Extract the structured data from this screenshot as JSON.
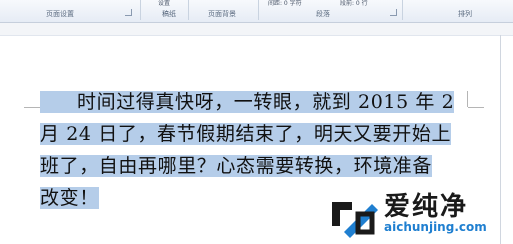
{
  "ribbon": {
    "group_labels": [
      "页面设置",
      "稿纸",
      "页面背景",
      "段落",
      "排列"
    ],
    "controls": [
      "设置",
      "间距: 0 字符",
      "段前: 0 行"
    ]
  },
  "document": {
    "lines": [
      "时间过得真快呀，一转眼，就到 2015 年 2",
      "月 24 日了，春节假期结束了，明天又要开始上",
      "班了，自由再哪里？心态需要转换，环境准备",
      "改变！"
    ]
  },
  "watermark": {
    "name": "爱纯净",
    "url": "aichunjing.com"
  },
  "colors": {
    "selection": "#b5cde9",
    "watermark_url": "#1f7fd0"
  }
}
